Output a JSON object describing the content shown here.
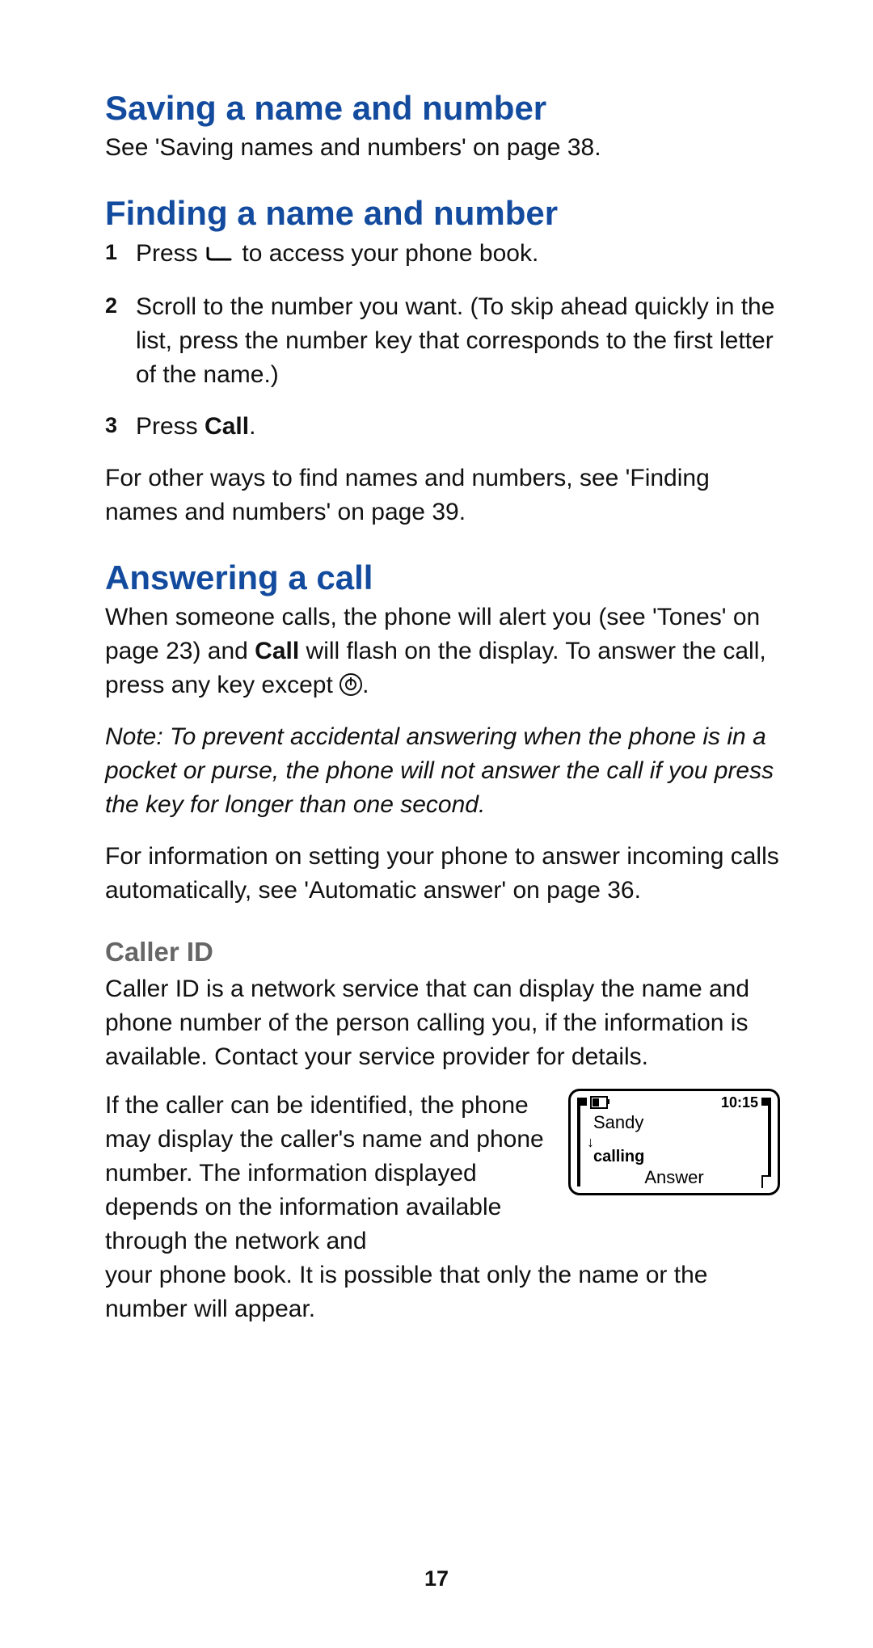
{
  "page_number": "17",
  "section1": {
    "heading": "Saving a name and number",
    "body": "See 'Saving names and numbers' on page 38."
  },
  "section2": {
    "heading": "Finding a name and number",
    "steps": {
      "n1": "1",
      "s1_a": "Press ",
      "s1_b": " to access your phone book.",
      "n2": "2",
      "s2": "Scroll to the number you want. (To skip ahead quickly in the list, press the number key that corresponds to the first letter of the name.)",
      "n3": "3",
      "s3_a": "Press ",
      "s3_b": "Call",
      "s3_c": "."
    },
    "after": "For other ways to find names and numbers, see 'Finding names and numbers' on page 39."
  },
  "section3": {
    "heading": "Answering a call",
    "p1_a": "When someone calls, the phone will alert you (see 'Tones' on page 23) and ",
    "p1_b": "Call",
    "p1_c": " will flash on the display. To answer the call, press any key except ",
    "p1_d": ".",
    "note": "Note:  To prevent accidental answering when the phone is in a pocket or purse, the phone will not answer the call if you press the key for longer than one second.",
    "p2": "For information on setting your phone to answer incoming calls automatically, see 'Automatic answer' on page 36."
  },
  "callerid": {
    "subhead": "Caller ID",
    "p1": "Caller ID is a network service that can display the name and phone number of the person calling you, if the information is available.  Contact your service provider for details.",
    "p2_left": "If the caller can be identified, the phone may display the caller's name and phone number. The information displayed depends on the information available through the network and",
    "p2_after": "your phone book. It is possible that only the name or the number will appear."
  },
  "phone_screen": {
    "time": "10:15",
    "name": "Sandy",
    "status": "calling",
    "softkey": "Answer"
  }
}
